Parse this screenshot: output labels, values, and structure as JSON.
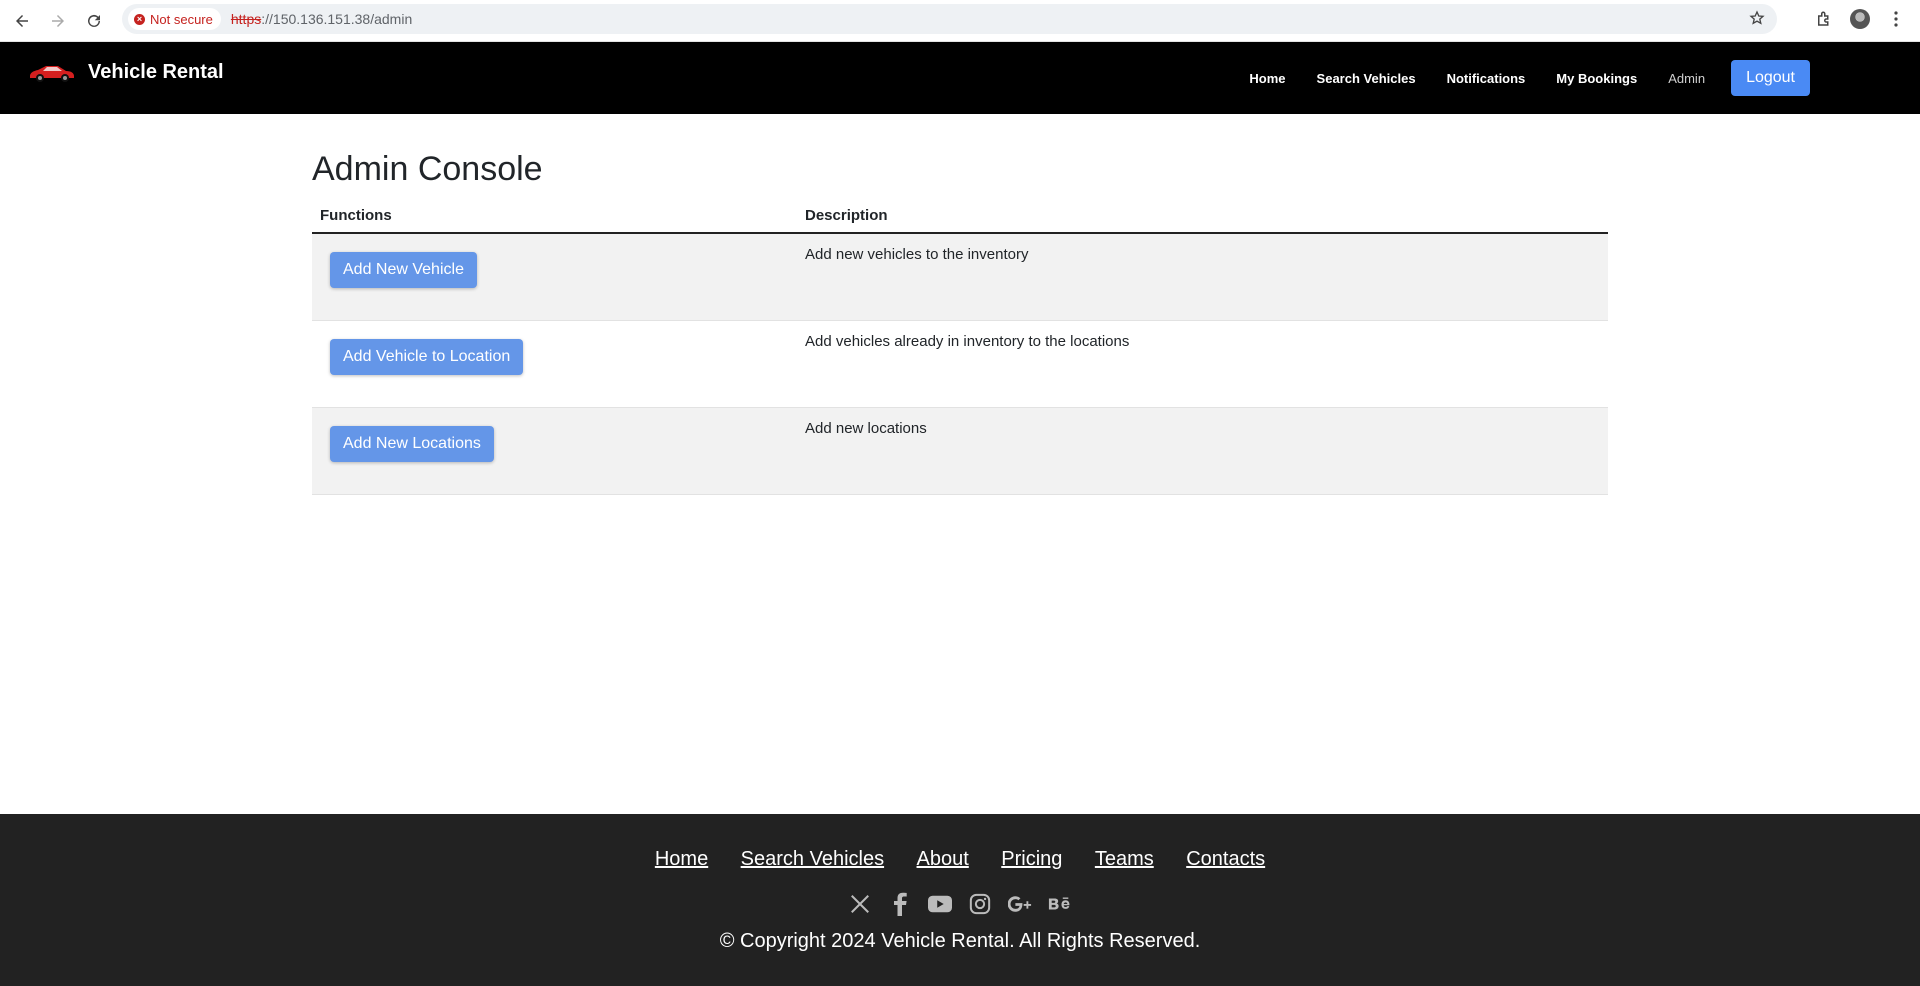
{
  "browser": {
    "security_label": "Not secure",
    "url_scheme": "https",
    "url_rest": "://150.136.151.38/admin"
  },
  "header": {
    "brand": "Vehicle Rental",
    "nav": [
      "Home",
      "Search Vehicles",
      "Notifications",
      "My Bookings",
      "Admin"
    ],
    "logout_label": "Logout"
  },
  "main": {
    "title": "Admin Console",
    "columns": [
      "Functions",
      "Description"
    ],
    "rows": [
      {
        "button": "Add New Vehicle",
        "description": "Add new vehicles to the inventory"
      },
      {
        "button": "Add Vehicle to Location",
        "description": "Add vehicles already in inventory to the locations"
      },
      {
        "button": "Add New Locations",
        "description": "Add new locations"
      }
    ]
  },
  "footer": {
    "links": [
      "Home",
      "Search Vehicles",
      "About",
      "Pricing",
      "Teams",
      "Contacts"
    ],
    "socials": [
      "x-icon",
      "facebook-icon",
      "youtube-icon",
      "instagram-icon",
      "google-plus-icon",
      "behance-icon"
    ],
    "copyright": "© Copyright 2024 Vehicle Rental. All Rights Reserved."
  },
  "colors": {
    "header_bg": "#000000",
    "button_blue": "#6496e8",
    "logout_blue": "#4a8af4",
    "footer_bg": "#222222"
  }
}
